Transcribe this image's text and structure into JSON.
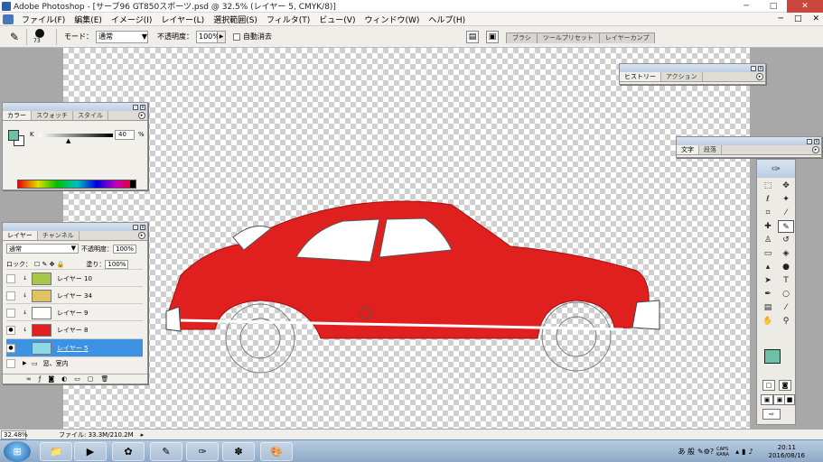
{
  "app": {
    "title": "Adobe Photoshop - [サーブ96 GT850スポーツ.psd @ 32.5% (レイヤー 5, CMYK/8)]",
    "win_controls": [
      "─",
      "□",
      "✕"
    ]
  },
  "menu": {
    "items": [
      "ファイル(F)",
      "編集(E)",
      "イメージ(I)",
      "レイヤー(L)",
      "選択範囲(S)",
      "フィルタ(T)",
      "ビュー(V)",
      "ウィンドウ(W)",
      "ヘルプ(H)"
    ],
    "right": [
      "─",
      "□",
      "✕"
    ]
  },
  "options": {
    "brush_size": "73",
    "mode_label": "モード：",
    "mode_value": "通常",
    "opacity_label": "不透明度：",
    "opacity_value": "100%",
    "airbrush_label": "自動消去",
    "well_tabs": [
      "ブラシ",
      "ツールプリセット",
      "レイヤーカンプ"
    ]
  },
  "history_panel": {
    "tabs": [
      "ヒストリー",
      "アクション"
    ]
  },
  "text_panel": {
    "tabs": [
      "文字",
      "段落"
    ]
  },
  "color_panel": {
    "tabs": [
      "カラー",
      "スウォッチ",
      "スタイル"
    ],
    "channel": "K",
    "value": "40",
    "unit": "%",
    "fg_color": "#6cc0a8"
  },
  "layers_panel": {
    "tabs": [
      "レイヤー",
      "チャンネル"
    ],
    "blend_mode": "通常",
    "opacity_label": "不透明度：",
    "opacity_value": "100%",
    "lock_label": "ロック：",
    "fill_label": "塗り：",
    "fill_value": "100%",
    "layers": [
      {
        "name": "レイヤー 10",
        "color": "#a8c84a",
        "visible": false,
        "selected": false
      },
      {
        "name": "レイヤー 34",
        "color": "#e0c262",
        "visible": false,
        "selected": false
      },
      {
        "name": "レイヤー 9",
        "color": "#ffffff",
        "visible": false,
        "selected": false
      },
      {
        "name": "レイヤー 8",
        "color": "#e02020",
        "visible": true,
        "selected": false
      },
      {
        "name": "レイヤー 5",
        "color": "#8fd8e8",
        "visible": true,
        "selected": true
      },
      {
        "name": "窓、室内",
        "color": "",
        "visible": false,
        "selected": false
      }
    ]
  },
  "status": {
    "zoom": "32.48%",
    "doc_info": "ファイル: 33.3M/210.2M"
  },
  "taskbar": {
    "time": "20:11",
    "date": "2016/08/16",
    "ime": "あ 般",
    "caps": "CAPS KANA"
  },
  "colors": {
    "car_red": "#e0201e",
    "selection_blue": "#3d92e3"
  }
}
